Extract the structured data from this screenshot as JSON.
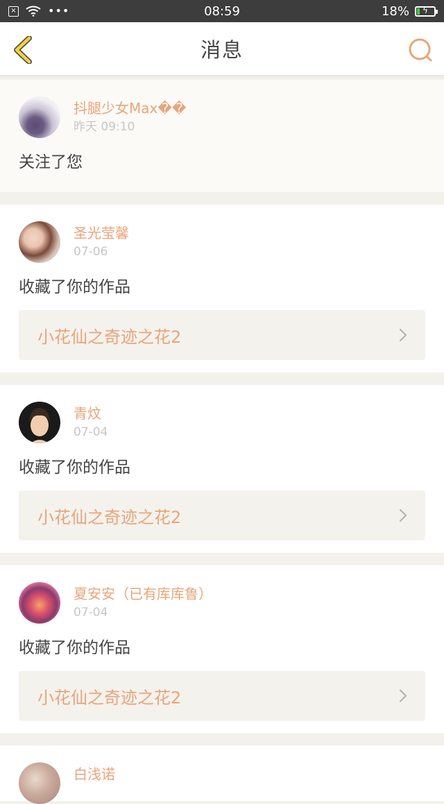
{
  "status_bar": {
    "time": "08:59",
    "battery_percent_text": "18%",
    "battery_level": 0.18,
    "dots": "•••"
  },
  "nav": {
    "title": "消息",
    "back_icon": "chevron-left-icon",
    "search_icon": "search-icon",
    "accent_color": "#e8a57a",
    "back_color": "#f0d34a"
  },
  "notifications": [
    {
      "user": "抖腿少女Max��",
      "time": "昨天 09:10",
      "action": "关注了您",
      "work": null
    },
    {
      "user": "圣光莹馨",
      "time": "07-06",
      "action": "收藏了你的作品",
      "work": "小花仙之奇迹之花2"
    },
    {
      "user": "青炆",
      "time": "07-04",
      "action": "收藏了你的作品",
      "work": "小花仙之奇迹之花2"
    },
    {
      "user": "夏安安（已有库库鲁）",
      "time": "07-04",
      "action": "收藏了你的作品",
      "work": "小花仙之奇迹之花2"
    },
    {
      "user": "白浅诺",
      "time": "",
      "action": "",
      "work": null
    }
  ]
}
